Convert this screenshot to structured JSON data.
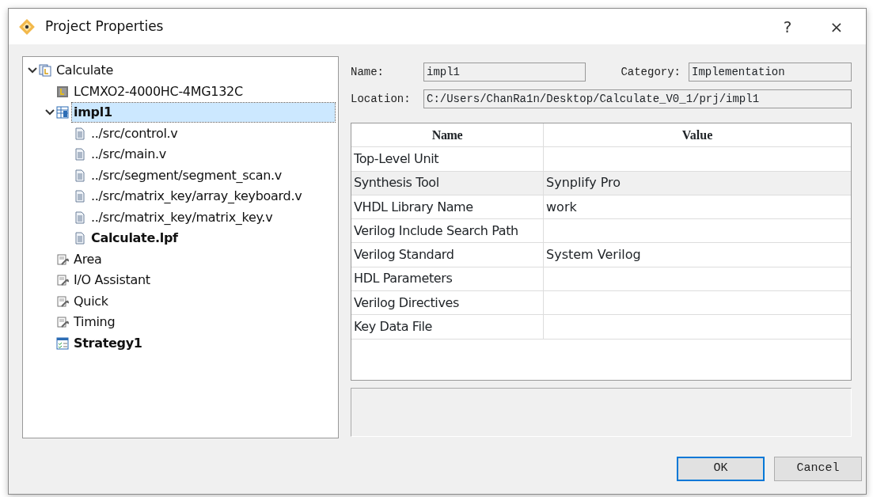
{
  "window": {
    "title": "Project Properties",
    "help": "?",
    "close": "×"
  },
  "tree": [
    {
      "label": "Calculate",
      "kind": "project",
      "bold": false,
      "selected": false,
      "expanded": true,
      "children": [
        {
          "label": "LCMXO2-4000HC-4MG132C",
          "kind": "device",
          "bold": false,
          "selected": false
        },
        {
          "label": "impl1",
          "kind": "implementation",
          "bold": true,
          "selected": true,
          "expanded": true,
          "children": [
            {
              "label": "../src/control.v",
              "kind": "file",
              "bold": false,
              "selected": false
            },
            {
              "label": "../src/main.v",
              "kind": "file",
              "bold": false,
              "selected": false
            },
            {
              "label": "../src/segment/segment_scan.v",
              "kind": "file",
              "bold": false,
              "selected": false
            },
            {
              "label": "../src/matrix_key/array_keyboard.v",
              "kind": "file",
              "bold": false,
              "selected": false
            },
            {
              "label": "../src/matrix_key/matrix_key.v",
              "kind": "file",
              "bold": false,
              "selected": false
            },
            {
              "label": "Calculate.lpf",
              "kind": "file",
              "bold": true,
              "selected": false
            }
          ]
        },
        {
          "label": "Area",
          "kind": "tool",
          "bold": false,
          "selected": false
        },
        {
          "label": "I/O Assistant",
          "kind": "tool",
          "bold": false,
          "selected": false
        },
        {
          "label": "Quick",
          "kind": "tool",
          "bold": false,
          "selected": false
        },
        {
          "label": "Timing",
          "kind": "tool",
          "bold": false,
          "selected": false
        },
        {
          "label": "Strategy1",
          "kind": "strategy",
          "bold": true,
          "selected": false
        }
      ]
    }
  ],
  "fields": {
    "name_label": "Name:",
    "name": "impl1",
    "category_label": "Category:",
    "category": "Implementation",
    "location_label": "Location:",
    "location": "C:/Users/ChanRa1n/Desktop/Calculate_V0_1/prj/impl1"
  },
  "table": {
    "columns": [
      "Name",
      "Value"
    ],
    "rows": [
      {
        "name": "Top-Level Unit",
        "value": "",
        "selected": false
      },
      {
        "name": "Synthesis Tool",
        "value": "Synplify Pro",
        "selected": true
      },
      {
        "name": "VHDL Library Name",
        "value": "work",
        "selected": false
      },
      {
        "name": "Verilog Include Search Path",
        "value": "",
        "selected": false
      },
      {
        "name": "Verilog Standard",
        "value": "System Verilog",
        "selected": false
      },
      {
        "name": "HDL Parameters",
        "value": "",
        "selected": false
      },
      {
        "name": "Verilog Directives",
        "value": "",
        "selected": false
      },
      {
        "name": "Key Data File",
        "value": "",
        "selected": false
      }
    ]
  },
  "buttons": [
    {
      "label": "OK",
      "default": true
    },
    {
      "label": "Cancel",
      "default": false
    }
  ]
}
